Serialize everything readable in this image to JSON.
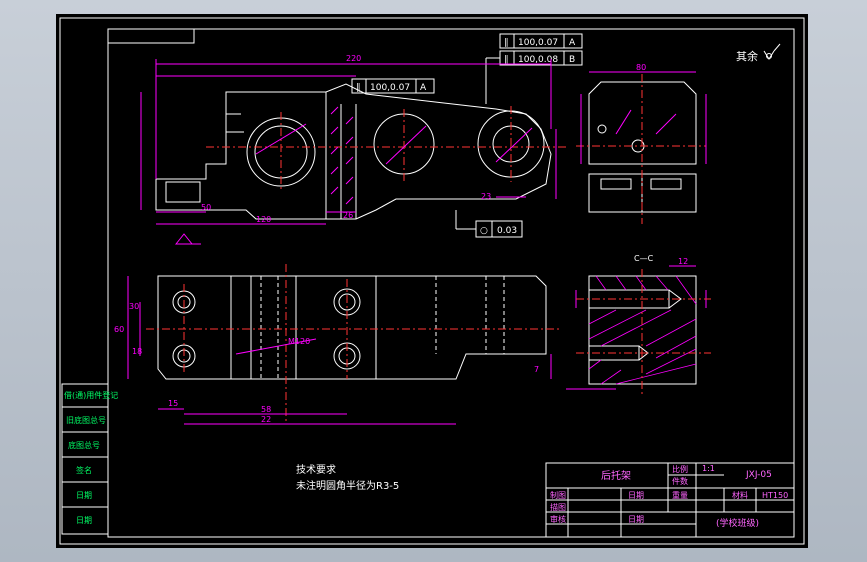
{
  "tolerance_frames": {
    "top_1": {
      "symbol": "∥",
      "value": "100,0.07",
      "datum": "A"
    },
    "top_2": {
      "symbol": "∥",
      "value": "100,0.08",
      "datum": "B"
    },
    "mid": {
      "symbol": "∥",
      "value": "100,0.07",
      "datum": "A"
    },
    "cyl": {
      "symbol": "○",
      "value": "0.03"
    }
  },
  "roughness_note": "其余",
  "section_label": "C—C",
  "dimensions": {
    "overall_length": "220",
    "d50": "50",
    "d120": "120",
    "d26": "26",
    "d23": "23",
    "d80": "80",
    "d12": "12",
    "d15": "15",
    "d58": "58",
    "d22": "22",
    "d30": "30",
    "d60": "60",
    "d18": "18",
    "m_label": "M120",
    "d7": "7"
  },
  "tech_requirements": {
    "title": "技术要求",
    "line1": "未注明圆角半径为R3-5"
  },
  "title_block": {
    "part_name": "后托架",
    "scale_label": "比例",
    "scale_value": "1:1",
    "drawing_no": "JXJ-05",
    "quantity_label": "件数",
    "drawn_label": "制图",
    "check_label": "审核",
    "date1": "日期",
    "date2": "日期",
    "weight_label": "重量",
    "material_label": "材料",
    "material_value": "HT150",
    "school": "(学校班级)",
    "side_label": "描图"
  },
  "left_panel": {
    "labels": [
      "借(通)用件登记",
      "旧底图总号",
      "底图总号",
      "签名",
      "日期",
      "日期"
    ]
  },
  "colors": {
    "background": "#000000",
    "frame": "#ffffff",
    "outline": "#ffffff",
    "dimension": "#ff00ff",
    "centerline": "#ff3333",
    "label_green": "#00ff66",
    "label_yellow": "#ffff00"
  }
}
